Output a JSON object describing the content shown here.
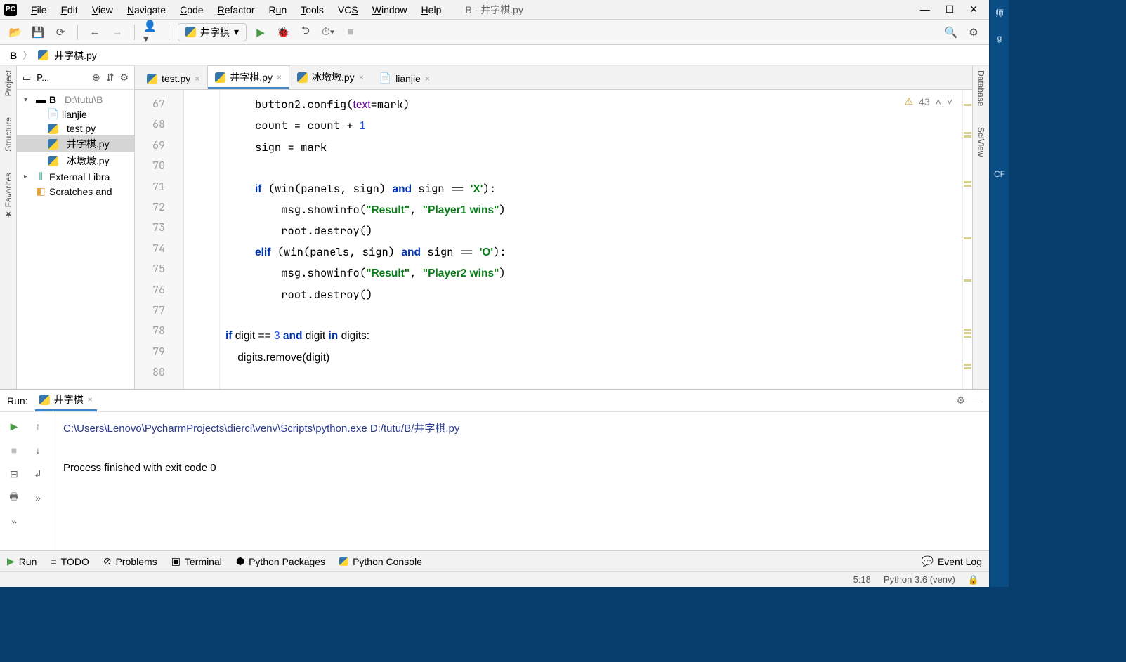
{
  "window": {
    "title": "B - 井字棋.py"
  },
  "menu": {
    "items": [
      "File",
      "Edit",
      "View",
      "Navigate",
      "Code",
      "Refactor",
      "Run",
      "Tools",
      "VCS",
      "Window",
      "Help"
    ]
  },
  "runconfig": {
    "name": "井字棋"
  },
  "breadcrumb": {
    "root": "B",
    "file": "井字棋.py"
  },
  "project": {
    "label": "P...",
    "root": {
      "name": "B",
      "path": "D:\\tutu\\B"
    },
    "files": [
      "lianjie",
      "test.py",
      "井字棋.py",
      "冰墩墩.py"
    ],
    "external": "External Libra",
    "scratches": "Scratches and"
  },
  "tabs": [
    {
      "name": "test.py",
      "icon": "py"
    },
    {
      "name": "井字棋.py",
      "icon": "py",
      "active": true
    },
    {
      "name": "冰墩墩.py",
      "icon": "py"
    },
    {
      "name": "lianjie",
      "icon": "txt"
    }
  ],
  "inspection": {
    "warnings": 43
  },
  "gutter": {
    "start": 67,
    "end": 80
  },
  "code": {
    "l67": "    button2.config(text=mark)",
    "l68": "    count = count + 1",
    "l69": "    sign = mark",
    "l70": "",
    "l71": "    if (win(panels, sign) and sign == 'X'):",
    "l72": "        msg.showinfo(\"Result\", \"Player1 wins\")",
    "l73": "        root.destroy()",
    "l74": "    elif (win(panels, sign) and sign == 'O'):",
    "l75": "        msg.showinfo(\"Result\", \"Player2 wins\")",
    "l76": "        root.destroy()",
    "l77": "",
    "l78": "if digit == 3 and digit in digits:",
    "l79": "    digits.remove(digit)"
  },
  "run": {
    "label": "Run:",
    "config": "井字棋",
    "cmd": "C:\\Users\\Lenovo\\PycharmProjects\\dierci\\venv\\Scripts\\python.exe D:/tutu/B/井字棋.py",
    "result": "Process finished with exit code 0"
  },
  "bottom": {
    "run": "Run",
    "todo": "TODO",
    "problems": "Problems",
    "terminal": "Terminal",
    "pypkg": "Python Packages",
    "pycons": "Python Console",
    "eventlog": "Event Log"
  },
  "status": {
    "pos": "5:18",
    "interp": "Python 3.6 (venv)"
  },
  "leftstrip": {
    "project": "Project",
    "structure": "Structure",
    "favorites": "Favorites"
  },
  "rightstrip": {
    "database": "Database",
    "sciview": "SciView"
  }
}
